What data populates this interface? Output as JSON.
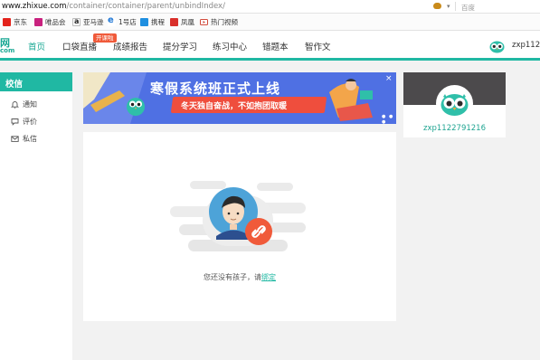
{
  "browser": {
    "url_domain": "www.zhixue.com",
    "url_path": "/container/container/parent/unbindIndex/",
    "search_engine": "百度"
  },
  "bookmarks": [
    {
      "label": "京东",
      "icon": "jd-icon"
    },
    {
      "label": "唯品会",
      "icon": "vip-icon"
    },
    {
      "label": "亚马逊",
      "icon": "amazon-icon"
    },
    {
      "label": "1号店",
      "icon": "ie-icon"
    },
    {
      "label": "携程",
      "icon": "ctrip-icon"
    },
    {
      "label": "凤凰",
      "icon": "ifeng-icon"
    },
    {
      "label": "热门视频",
      "icon": "video-icon"
    }
  ],
  "nav": {
    "logo_top": "网",
    "logo_bottom": "com",
    "tabs": [
      {
        "label": "首页",
        "active": true
      },
      {
        "label": "口袋直播"
      },
      {
        "label": "成绩报告"
      },
      {
        "label": "提分学习"
      },
      {
        "label": "练习中心"
      },
      {
        "label": "错题本"
      },
      {
        "label": "智作文"
      }
    ],
    "badge": "开课啦",
    "user": "zxp112..."
  },
  "sidebar": {
    "title": "校信",
    "items": [
      {
        "label": "通知",
        "icon": "bell-icon"
      },
      {
        "label": "评价",
        "icon": "comment-icon"
      },
      {
        "label": "私信",
        "icon": "mail-icon"
      }
    ]
  },
  "banner": {
    "title": "寒假系统班正式上线",
    "subtitle": "冬天独自奋战，不如抱团取暖",
    "close": "×",
    "dots": "● ● ●"
  },
  "main": {
    "empty_text": "您还没有孩子，请",
    "bind_link": "绑定"
  },
  "profile": {
    "username": "zxp1122791216"
  },
  "colors": {
    "accent": "#20b8a3",
    "banner_bg": "#4f70e3",
    "banner_ribbon": "#ef4e3d",
    "badge": "#f05a3a"
  }
}
